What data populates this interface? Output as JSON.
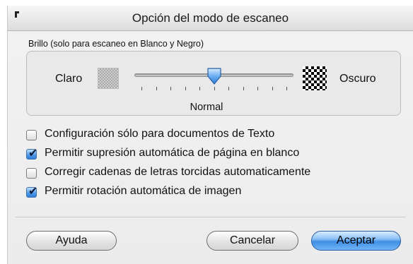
{
  "dialog": {
    "title": "Opción del modo de escaneo"
  },
  "brightness": {
    "group_label": "Brillo (solo para escaneo en Blanco y Negro)",
    "left_label": "Claro",
    "right_label": "Oscuro",
    "value_label": "Normal",
    "slider_value_fraction": 0.5,
    "tick_count": 11,
    "light_swatch_icon": "light-pattern-icon",
    "dark_swatch_icon": "dark-pattern-icon"
  },
  "options": [
    {
      "label": "Configuración sólo para documentos de Texto",
      "checked": false
    },
    {
      "label": "Permitir supresión automática de página en blanco",
      "checked": true
    },
    {
      "label": "Corregir cadenas de letras torcidas automaticamente",
      "checked": false
    },
    {
      "label": "Permitir rotación automática de imagen",
      "checked": true
    }
  ],
  "buttons": {
    "help": "Ayuda",
    "cancel": "Cancelar",
    "ok": "Aceptar"
  },
  "colors": {
    "accent": "#3f8fe6",
    "check_mark": "#0b1b3a"
  }
}
